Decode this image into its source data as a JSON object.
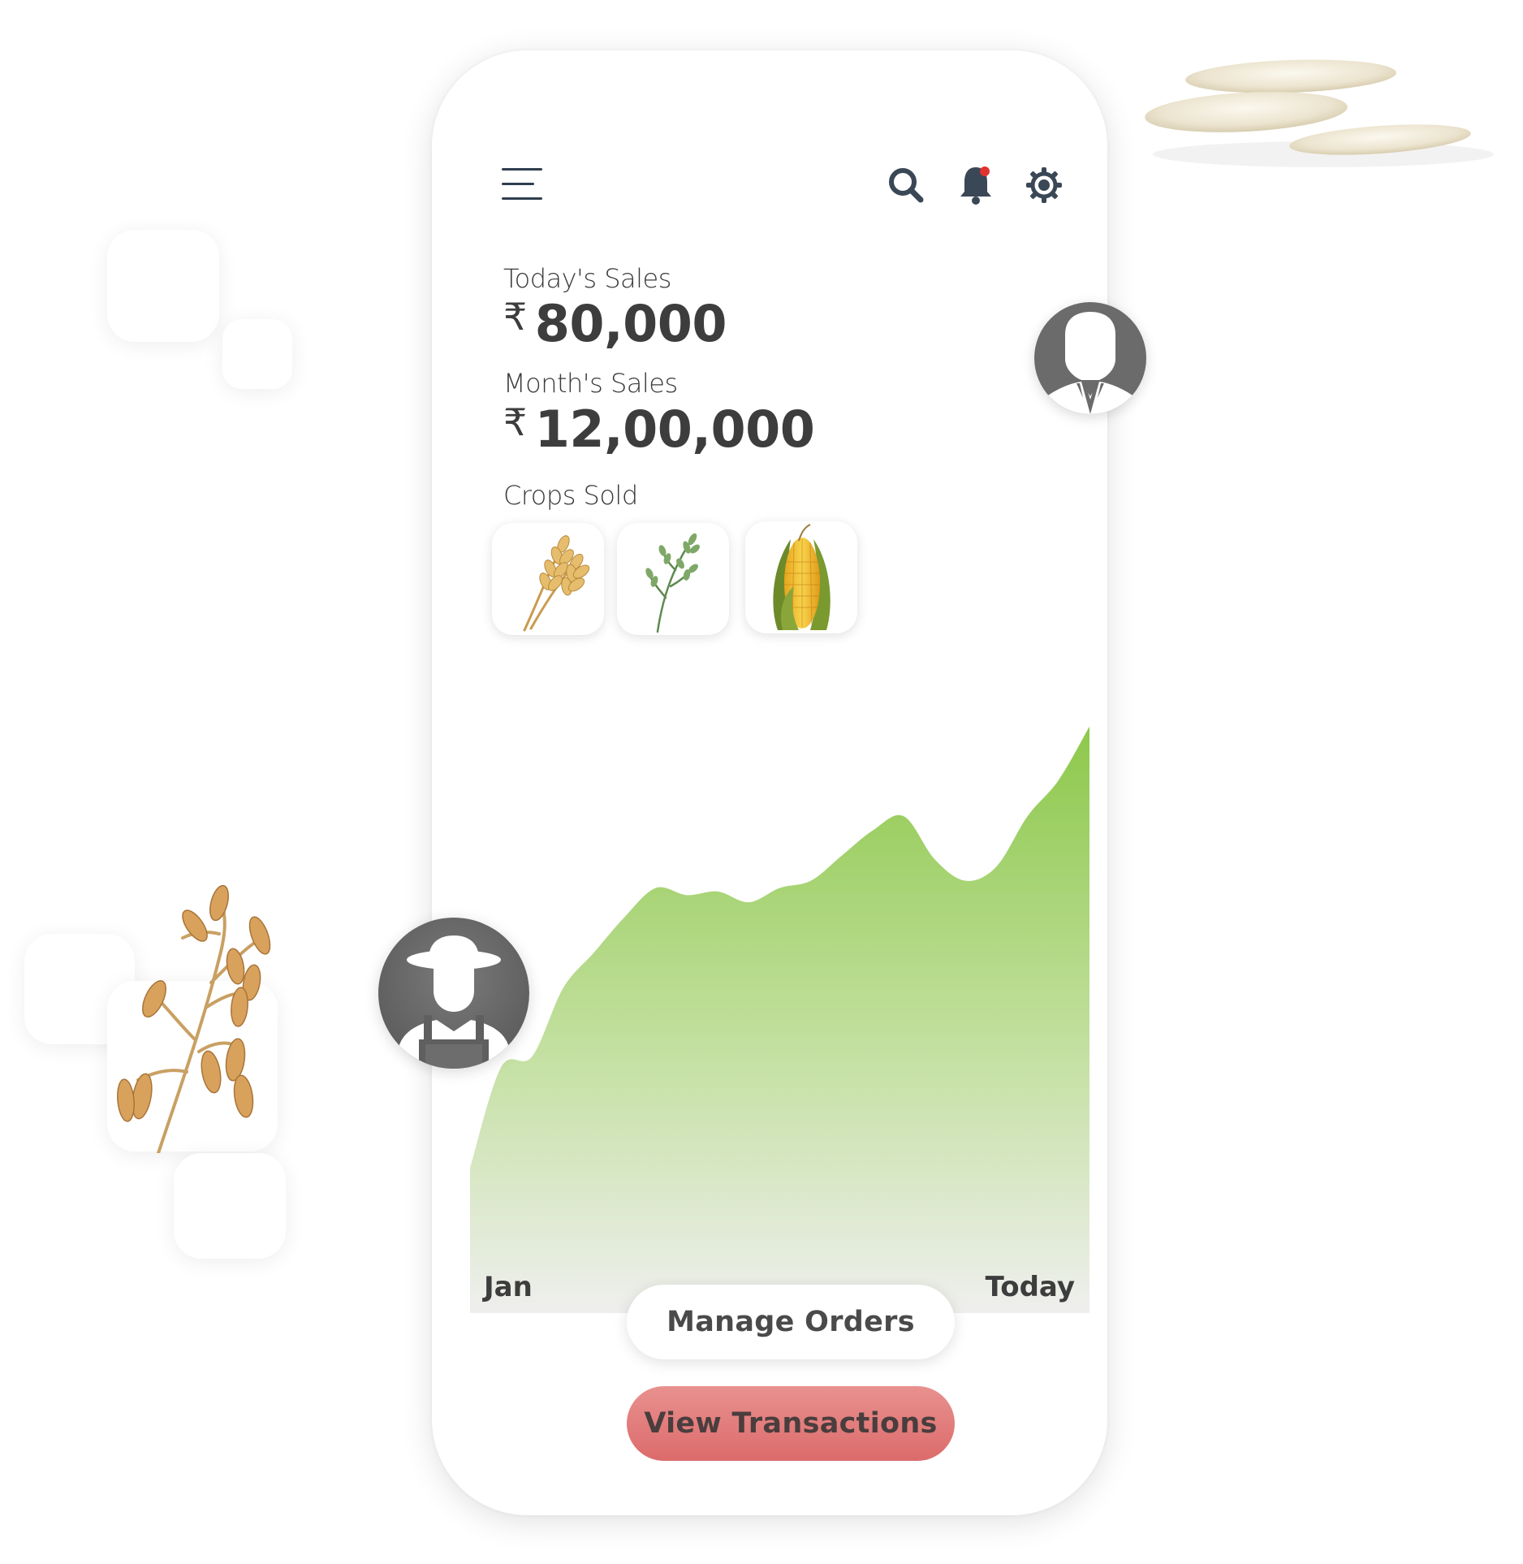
{
  "header": {
    "menu_icon": "hamburger-menu-icon",
    "search_icon": "search-icon",
    "notification_icon": "bell-icon",
    "settings_icon": "gear-icon"
  },
  "sales": {
    "today_label": "Today's Sales",
    "today_currency": "₹",
    "today_value": "80,000",
    "month_label": "Month's Sales",
    "month_currency": "₹",
    "month_value": "12,00,000"
  },
  "crops": {
    "label": "Crops Sold",
    "items": [
      {
        "icon": "wheat-icon"
      },
      {
        "icon": "millet-icon"
      },
      {
        "icon": "corn-icon"
      }
    ]
  },
  "chart": {
    "x_start_label": "Jan",
    "x_end_label": "Today",
    "fill_top_color": "#8dc84b",
    "fill_bottom_color": "#efefee"
  },
  "chart_data": {
    "type": "area",
    "x": [
      "Jan",
      "Today"
    ],
    "series": [
      {
        "values": [
          2,
          30,
          33,
          52,
          62,
          72,
          80,
          78,
          79,
          76,
          80,
          82,
          89,
          96,
          100,
          88,
          82,
          86,
          100,
          110,
          125
        ]
      }
    ],
    "xlabel": "",
    "ylabel": "",
    "grid": false
  },
  "actions": {
    "manage_orders_label": "Manage Orders",
    "view_transactions_label": "View Transactions",
    "accent_color": "#e07575"
  },
  "avatars": {
    "business_user": "businessman-avatar-icon",
    "farmer_user": "farmer-avatar-icon"
  }
}
